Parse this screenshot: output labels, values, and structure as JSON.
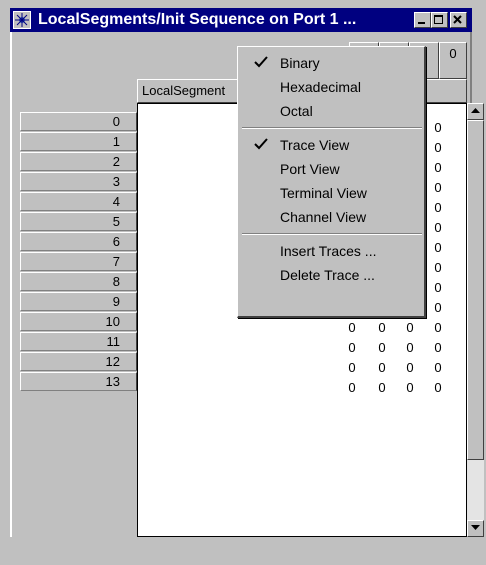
{
  "window": {
    "title": "LocalSegments/Init Sequence on Port 1 ..."
  },
  "grid": {
    "column_header_label": "LocalSegment",
    "top_header_value": "0",
    "row_labels": [
      "0",
      "1",
      "2",
      "3",
      "4",
      "5",
      "6",
      "7",
      "8",
      "9",
      "10",
      "11",
      "12",
      "13"
    ],
    "cells": [
      [
        "",
        "",
        "",
        "0"
      ],
      [
        "",
        "",
        "",
        "0"
      ],
      [
        "",
        "",
        "",
        "0"
      ],
      [
        "",
        "",
        "",
        "0"
      ],
      [
        "",
        "",
        "",
        "0"
      ],
      [
        "",
        "",
        "",
        "0"
      ],
      [
        "",
        "",
        "",
        "0"
      ],
      [
        "0",
        "0",
        "0",
        "0"
      ],
      [
        "0",
        "0",
        "0",
        "0"
      ],
      [
        "0",
        "0",
        "0",
        "0"
      ],
      [
        "0",
        "0",
        "0",
        "0"
      ],
      [
        "0",
        "0",
        "0",
        "0"
      ],
      [
        "0",
        "0",
        "0",
        "0"
      ],
      [
        "0",
        "0",
        "0",
        "0"
      ]
    ]
  },
  "context_menu": {
    "items": [
      {
        "label": "Binary",
        "checked": true
      },
      {
        "label": "Hexadecimal",
        "checked": false
      },
      {
        "label": "Octal",
        "checked": false
      },
      {
        "separator": true
      },
      {
        "label": "Trace View",
        "checked": true
      },
      {
        "label": "Port View",
        "checked": false
      },
      {
        "label": "Terminal View",
        "checked": false
      },
      {
        "label": "Channel View",
        "checked": false
      },
      {
        "separator": true
      },
      {
        "label": "Insert Traces ...",
        "checked": false
      },
      {
        "label": "Delete Trace ...",
        "checked": false
      }
    ]
  },
  "icons": {
    "app": "app-grid-icon",
    "minimize": "minimize-icon",
    "maximize": "maximize-icon",
    "close": "close-icon",
    "check": "check-icon",
    "scroll_up": "arrow-up-icon",
    "scroll_down": "arrow-down-icon"
  },
  "colors": {
    "titlebar": "#000080",
    "face": "#c0c0c0",
    "grid_bg": "#ffffff"
  }
}
